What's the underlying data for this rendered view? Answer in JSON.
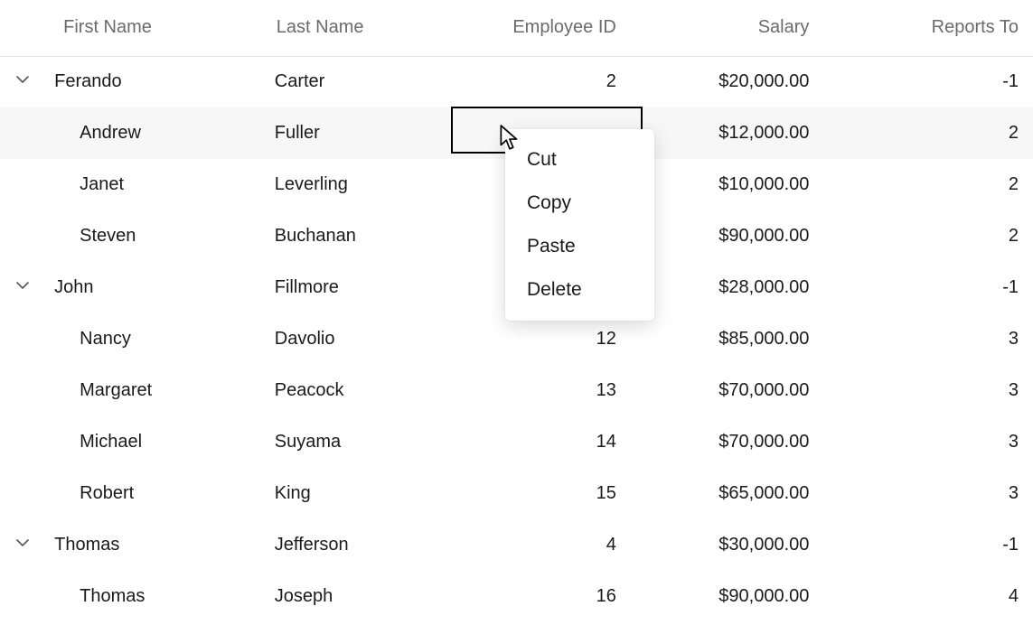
{
  "headers": {
    "first_name": "First Name",
    "last_name": "Last Name",
    "employee_id": "Employee ID",
    "salary": "Salary",
    "reports_to": "Reports To"
  },
  "rows": [
    {
      "expand": true,
      "level": 0,
      "first": "Ferando",
      "last": "Carter",
      "emp": "2",
      "salary": "$20,000.00",
      "reports": "-1",
      "highlight": false
    },
    {
      "expand": false,
      "level": 1,
      "first": "Andrew",
      "last": "Fuller",
      "emp": "",
      "salary": "$12,000.00",
      "reports": "2",
      "highlight": true
    },
    {
      "expand": false,
      "level": 1,
      "first": "Janet",
      "last": "Leverling",
      "emp": "",
      "salary": "$10,000.00",
      "reports": "2",
      "highlight": false
    },
    {
      "expand": false,
      "level": 1,
      "first": "Steven",
      "last": "Buchanan",
      "emp": "",
      "salary": "$90,000.00",
      "reports": "2",
      "highlight": false
    },
    {
      "expand": true,
      "level": 0,
      "first": "John",
      "last": "Fillmore",
      "emp": "",
      "salary": "$28,000.00",
      "reports": "-1",
      "highlight": false
    },
    {
      "expand": false,
      "level": 1,
      "first": "Nancy",
      "last": "Davolio",
      "emp": "12",
      "salary": "$85,000.00",
      "reports": "3",
      "highlight": false
    },
    {
      "expand": false,
      "level": 1,
      "first": "Margaret",
      "last": "Peacock",
      "emp": "13",
      "salary": "$70,000.00",
      "reports": "3",
      "highlight": false
    },
    {
      "expand": false,
      "level": 1,
      "first": "Michael",
      "last": "Suyama",
      "emp": "14",
      "salary": "$70,000.00",
      "reports": "3",
      "highlight": false
    },
    {
      "expand": false,
      "level": 1,
      "first": "Robert",
      "last": "King",
      "emp": "15",
      "salary": "$65,000.00",
      "reports": "3",
      "highlight": false
    },
    {
      "expand": true,
      "level": 0,
      "first": "Thomas",
      "last": "Jefferson",
      "emp": "4",
      "salary": "$30,000.00",
      "reports": "-1",
      "highlight": false
    },
    {
      "expand": false,
      "level": 1,
      "first": "Thomas",
      "last": "Joseph",
      "emp": "16",
      "salary": "$90,000.00",
      "reports": "4",
      "highlight": false
    }
  ],
  "context_menu": {
    "items": [
      "Cut",
      "Copy",
      "Paste",
      "Delete"
    ]
  }
}
